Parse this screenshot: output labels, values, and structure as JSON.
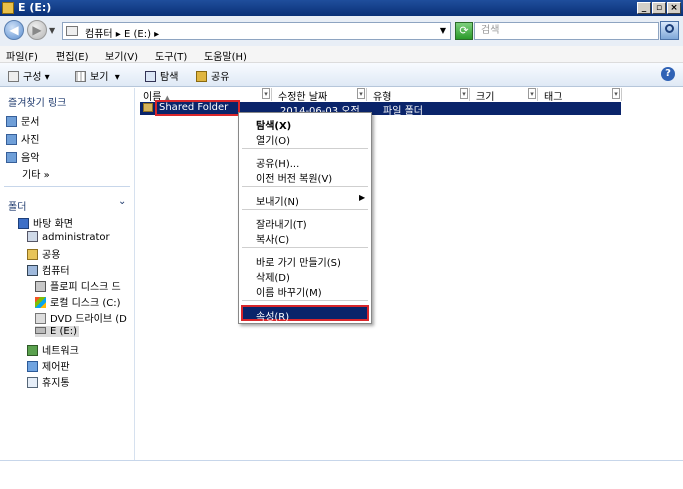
{
  "window": {
    "title": "E (E:)"
  },
  "address": {
    "crumbs": "컴퓨터 ▸ E (E:) ▸"
  },
  "search": {
    "placeholder": "검색"
  },
  "menu": [
    "파일(F)",
    "편집(E)",
    "보기(V)",
    "도구(T)",
    "도움말(H)"
  ],
  "toolbar": {
    "organize": "구성",
    "views": "보기",
    "explore": "탐색",
    "share": "공유"
  },
  "nav": {
    "favorites_title": "즐겨찾기 링크",
    "favorites": [
      "문서",
      "사진",
      "음악"
    ],
    "more": "기타",
    "folders_title": "폴더",
    "tree": [
      "바탕 화면",
      "administrator",
      "공용",
      "컴퓨터",
      "플로피 디스크 드",
      "로컬 디스크 (C:)",
      "DVD 드라이브 (D",
      "E (E:)",
      "네트워크",
      "제어판",
      "휴지통"
    ]
  },
  "columns": [
    "이름",
    "수정한 날짜",
    "유형",
    "크기",
    "태그"
  ],
  "files": [
    {
      "name": "Shared Folder",
      "date": "2014-06-03 오전",
      "type": "파일 폴더",
      "size": "",
      "tags": ""
    }
  ],
  "context_menu": {
    "explore": "탐색(X)",
    "open": "열기(O)",
    "share": "공유(H)...",
    "restore": "이전 버전 복원(V)",
    "send_to": "보내기(N)",
    "cut": "잘라내기(T)",
    "copy": "복사(C)",
    "shortcut": "바로 가기 만들기(S)",
    "delete": "삭제(D)",
    "rename": "이름 바꾸기(M)",
    "properties": "속성(R)"
  },
  "colors": {
    "selection": "#0a246a",
    "highlight_border": "#d9262b",
    "titlebar": "#0a3077"
  }
}
